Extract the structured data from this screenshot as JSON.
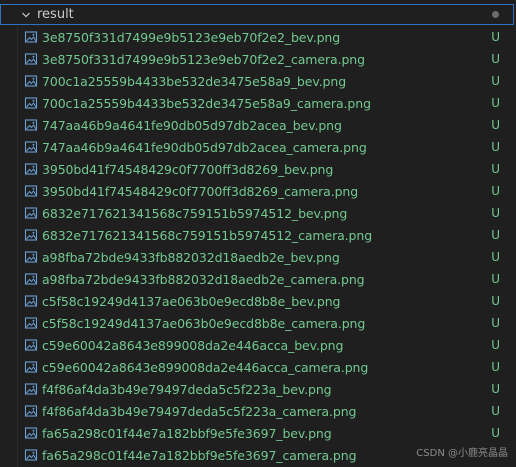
{
  "folder": {
    "name": "result",
    "icon": "chevron-down-icon",
    "status_color": "#6c6c6c"
  },
  "colors": {
    "untracked": "#73c991",
    "focus_border": "#2f74c0",
    "background": "#1f1f1f",
    "image_icon": "#6a9fd4"
  },
  "files": [
    {
      "name": "3e8750f331d7499e9b5123e9eb70f2e2_bev.png",
      "status": "U"
    },
    {
      "name": "3e8750f331d7499e9b5123e9eb70f2e2_camera.png",
      "status": "U"
    },
    {
      "name": "700c1a25559b4433be532de3475e58a9_bev.png",
      "status": "U"
    },
    {
      "name": "700c1a25559b4433be532de3475e58a9_camera.png",
      "status": "U"
    },
    {
      "name": "747aa46b9a4641fe90db05d97db2acea_bev.png",
      "status": "U"
    },
    {
      "name": "747aa46b9a4641fe90db05d97db2acea_camera.png",
      "status": "U"
    },
    {
      "name": "3950bd41f74548429c0f7700ff3d8269_bev.png",
      "status": "U"
    },
    {
      "name": "3950bd41f74548429c0f7700ff3d8269_camera.png",
      "status": "U"
    },
    {
      "name": "6832e717621341568c759151b5974512_bev.png",
      "status": "U"
    },
    {
      "name": "6832e717621341568c759151b5974512_camera.png",
      "status": "U"
    },
    {
      "name": "a98fba72bde9433fb882032d18aedb2e_bev.png",
      "status": "U"
    },
    {
      "name": "a98fba72bde9433fb882032d18aedb2e_camera.png",
      "status": "U"
    },
    {
      "name": "c5f58c19249d4137ae063b0e9ecd8b8e_bev.png",
      "status": "U"
    },
    {
      "name": "c5f58c19249d4137ae063b0e9ecd8b8e_camera.png",
      "status": "U"
    },
    {
      "name": "c59e60042a8643e899008da2e446acca_bev.png",
      "status": "U"
    },
    {
      "name": "c59e60042a8643e899008da2e446acca_camera.png",
      "status": "U"
    },
    {
      "name": "f4f86af4da3b49e79497deda5c5f223a_bev.png",
      "status": "U"
    },
    {
      "name": "f4f86af4da3b49e79497deda5c5f223a_camera.png",
      "status": "U"
    },
    {
      "name": "fa65a298c01f44e7a182bbf9e5fe3697_bev.png",
      "status": "U"
    },
    {
      "name": "fa65a298c01f44e7a182bbf9e5fe3697_camera.png",
      "status": ""
    }
  ],
  "watermark": "CSDN @小鹿亮晶晶"
}
